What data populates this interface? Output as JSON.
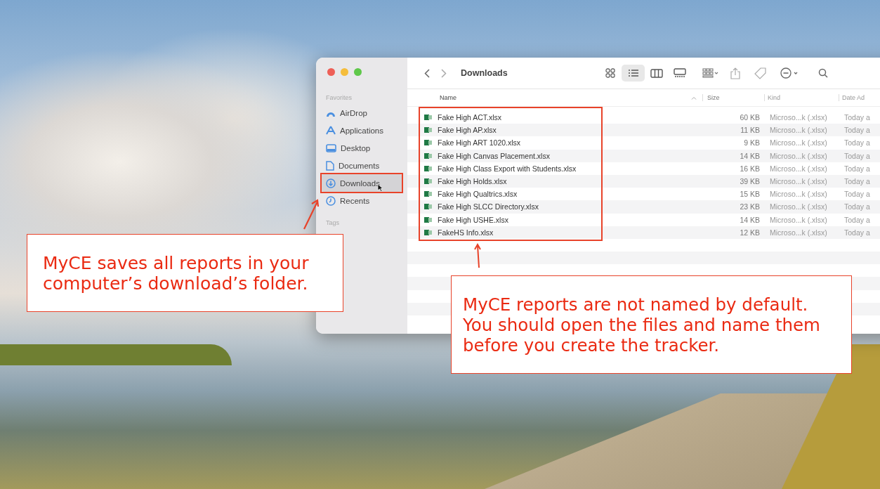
{
  "finder": {
    "title": "Downloads",
    "view_modes": [
      {
        "kind": "icons",
        "selected": false
      },
      {
        "kind": "list",
        "selected": true
      },
      {
        "kind": "columns",
        "selected": false
      },
      {
        "kind": "gallery",
        "selected": false
      }
    ],
    "sidebar": {
      "sections": [
        {
          "title": "Favorites",
          "items": [
            {
              "label": "AirDrop",
              "kind": "airdrop",
              "selected": false
            },
            {
              "label": "Applications",
              "kind": "applications",
              "selected": false
            },
            {
              "label": "Desktop",
              "kind": "desktop",
              "selected": false
            },
            {
              "label": "Documents",
              "kind": "documents",
              "selected": false
            },
            {
              "label": "Downloads",
              "kind": "downloads",
              "selected": true
            },
            {
              "label": "Recents",
              "kind": "recents",
              "selected": false
            }
          ]
        },
        {
          "title": "Tags"
        }
      ]
    },
    "table": {
      "columns": [
        "Name",
        "Size",
        "Kind",
        "Date Ad"
      ],
      "rows": [
        {
          "name": "Fake High ACT.xlsx",
          "size": "60 KB",
          "kind": "Microso...k (.xlsx)",
          "date": "Today a"
        },
        {
          "name": "Fake High AP.xlsx",
          "size": "11 KB",
          "kind": "Microso...k (.xlsx)",
          "date": "Today a"
        },
        {
          "name": "Fake High ART 1020.xlsx",
          "size": "9 KB",
          "kind": "Microso...k (.xlsx)",
          "date": "Today a"
        },
        {
          "name": "Fake High Canvas Placement.xlsx",
          "size": "14 KB",
          "kind": "Microso...k (.xlsx)",
          "date": "Today a"
        },
        {
          "name": "Fake High Class Export with Students.xlsx",
          "size": "16 KB",
          "kind": "Microso...k (.xlsx)",
          "date": "Today a"
        },
        {
          "name": "Fake High Holds.xlsx",
          "size": "39 KB",
          "kind": "Microso...k (.xlsx)",
          "date": "Today a"
        },
        {
          "name": "Fake High Qualtrics.xlsx",
          "size": "15 KB",
          "kind": "Microso...k (.xlsx)",
          "date": "Today a"
        },
        {
          "name": "Fake High SLCC Directory.xlsx",
          "size": "23 KB",
          "kind": "Microso...k (.xlsx)",
          "date": "Today a"
        },
        {
          "name": "Fake High USHE.xlsx",
          "size": "14 KB",
          "kind": "Microso...k (.xlsx)",
          "date": "Today a"
        },
        {
          "name": "FakeHS Info.xlsx",
          "size": "12 KB",
          "kind": "Microso...k (.xlsx)",
          "date": "Today a"
        }
      ]
    }
  },
  "callouts": [
    {
      "text": "MyCE saves all reports in your computer’s download’s folder."
    },
    {
      "text": "MyCE reports are not named by default. You should open the files and name them before you create the tracker."
    }
  ]
}
